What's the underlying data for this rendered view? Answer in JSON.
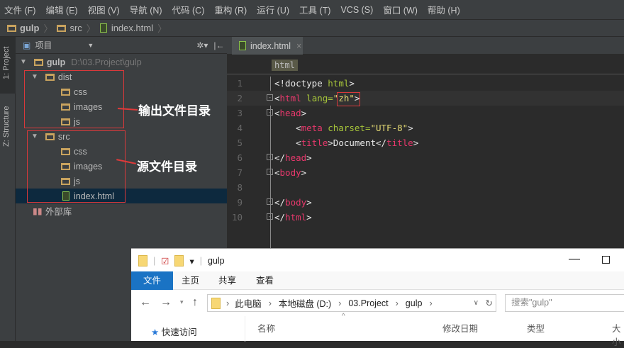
{
  "menu": [
    "文件 (F)",
    "编辑 (E)",
    "视图 (V)",
    "导航 (N)",
    "代码 (C)",
    "重构 (R)",
    "运行 (U)",
    "工具 (T)",
    "VCS (S)",
    "窗口 (W)",
    "帮助 (H)"
  ],
  "breadcrumb": [
    "gulp",
    "src",
    "index.html"
  ],
  "side_tabs": {
    "project": "1: Project",
    "structure": "Z: Structure"
  },
  "project": {
    "view_label": "项目",
    "root": "gulp",
    "root_path": "D:\\03.Project\\gulp",
    "tree": [
      {
        "label": "dist"
      },
      {
        "label": "css"
      },
      {
        "label": "images"
      },
      {
        "label": "js"
      },
      {
        "label": "src"
      },
      {
        "label": "css"
      },
      {
        "label": "images"
      },
      {
        "label": "js"
      },
      {
        "label": "index.html"
      }
    ],
    "external_libs": "外部库"
  },
  "annotations": {
    "dist": "输出文件目录",
    "src": "源文件目录"
  },
  "editor": {
    "tab": "index.html",
    "tag_crumb": "html",
    "lines": [
      {
        "n": "1",
        "t": [
          [
            "<!doctype ",
            "p"
          ],
          [
            "html",
            "a"
          ],
          [
            ">",
            "p"
          ]
        ]
      },
      {
        "n": "2",
        "t": [
          [
            "<",
            "p"
          ],
          [
            "html",
            "t"
          ],
          [
            " lang=",
            "a"
          ],
          [
            "\"zh\"",
            "s"
          ],
          [
            ">",
            "p"
          ]
        ]
      },
      {
        "n": "3",
        "t": [
          [
            "<",
            "p"
          ],
          [
            "head",
            "t"
          ],
          [
            ">",
            "p"
          ]
        ]
      },
      {
        "n": "4",
        "t": [
          [
            "    <",
            "p"
          ],
          [
            "meta",
            "t"
          ],
          [
            " charset=",
            "a"
          ],
          [
            "\"UTF-8\"",
            "s"
          ],
          [
            ">",
            "p"
          ]
        ]
      },
      {
        "n": "5",
        "t": [
          [
            "    <",
            "p"
          ],
          [
            "title",
            "t"
          ],
          [
            ">Document</",
            "p"
          ],
          [
            "title",
            "t"
          ],
          [
            ">",
            "p"
          ]
        ]
      },
      {
        "n": "6",
        "t": [
          [
            "</",
            "p"
          ],
          [
            "head",
            "t"
          ],
          [
            ">",
            "p"
          ]
        ]
      },
      {
        "n": "7",
        "t": [
          [
            "<",
            "p"
          ],
          [
            "body",
            "t"
          ],
          [
            ">",
            "p"
          ]
        ]
      },
      {
        "n": "8",
        "t": []
      },
      {
        "n": "9",
        "t": [
          [
            "</",
            "p"
          ],
          [
            "body",
            "t"
          ],
          [
            ">",
            "p"
          ]
        ]
      },
      {
        "n": "10",
        "t": [
          [
            "</",
            "p"
          ],
          [
            "html",
            "t"
          ],
          [
            ">",
            "p"
          ]
        ]
      }
    ]
  },
  "explorer": {
    "title": "gulp",
    "tabs": [
      "文件",
      "主页",
      "共享",
      "查看"
    ],
    "path": [
      "此电脑",
      "本地磁盘 (D:)",
      "03.Project",
      "gulp"
    ],
    "search_placeholder": "搜索\"gulp\"",
    "quick_access": "快速访问",
    "columns": [
      "名称",
      "修改日期",
      "类型",
      "大小"
    ]
  }
}
